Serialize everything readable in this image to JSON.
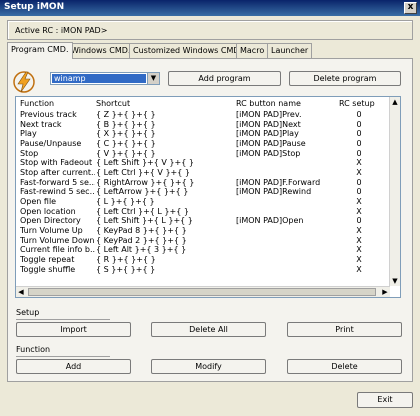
{
  "window": {
    "title": "Setup iMON",
    "close_label": "x"
  },
  "active_rc": "Active RC : iMON PAD>",
  "tabs": [
    "Program CMD.",
    "Windows CMD.",
    "Customized Windows CMD.",
    "Macro",
    "Launcher"
  ],
  "program": {
    "selected": "winamp",
    "add_label": "Add program",
    "delete_label": "Delete program"
  },
  "columns": [
    "Function",
    "Shortcut",
    "RC button name",
    "RC setup"
  ],
  "rows": [
    [
      "Previous track",
      "{ Z }+{  }+{  }",
      "[iMON PAD]Prev.",
      "0"
    ],
    [
      "Next track",
      "{ B }+{  }+{  }",
      "[iMON PAD]Next",
      "0"
    ],
    [
      "Play",
      "{ X }+{  }+{  }",
      "[iMON PAD]Play",
      "0"
    ],
    [
      "Pause/Unpause",
      "{ C }+{  }+{  }",
      "[iMON PAD]Pause",
      "0"
    ],
    [
      "Stop",
      "{ V }+{  }+{  }",
      "[iMON PAD]Stop",
      "0"
    ],
    [
      "Stop with Fadeout",
      "{ Left Shift }+{ V }+{  }",
      "",
      "X"
    ],
    [
      "Stop after current...",
      "{ Left Ctrl }+{ V }+{  }",
      "",
      "X"
    ],
    [
      "Fast-forward 5 se...",
      "{ RightArrow }+{  }+{  }",
      "[iMON PAD]F.Forward",
      "0"
    ],
    [
      "Fast-rewind 5 sec...",
      "{ LeftArrow }+{  }+{  }",
      "[iMON PAD]Rewind",
      "0"
    ],
    [
      "Open file",
      "{ L }+{  }+{  }",
      "",
      "X"
    ],
    [
      "Open location",
      "{ Left Ctrl }+{ L }+{  }",
      "",
      "X"
    ],
    [
      "Open Directory",
      "{ Left Shift }+{ L }+{  }",
      "[iMON PAD]Open",
      "0"
    ],
    [
      "Turn Volume Up",
      "{ KeyPad 8 }+{  }+{  }",
      "",
      "X"
    ],
    [
      "Turn Volume Down",
      "{ KeyPad 2 }+{  }+{  }",
      "",
      "X"
    ],
    [
      "Current file info b...",
      "{ Left Alt }+{ 3 }+{  }",
      "",
      "X"
    ],
    [
      "Toggle repeat",
      "{ R }+{  }+{  }",
      "",
      "X"
    ],
    [
      "Toggle shuffle",
      "{ S }+{  }+{  }",
      "",
      "X"
    ]
  ],
  "setup": {
    "label": "Setup",
    "import": "Import",
    "delete_all": "Delete All",
    "print": "Print"
  },
  "function": {
    "label": "Function",
    "add": "Add",
    "modify": "Modify",
    "delete": "Delete"
  },
  "exit": "Exit",
  "colors": {
    "title_start": "#0a246a",
    "title_end": "#3a6ea5",
    "selection": "#316ac5",
    "logo": "#f0a020"
  }
}
